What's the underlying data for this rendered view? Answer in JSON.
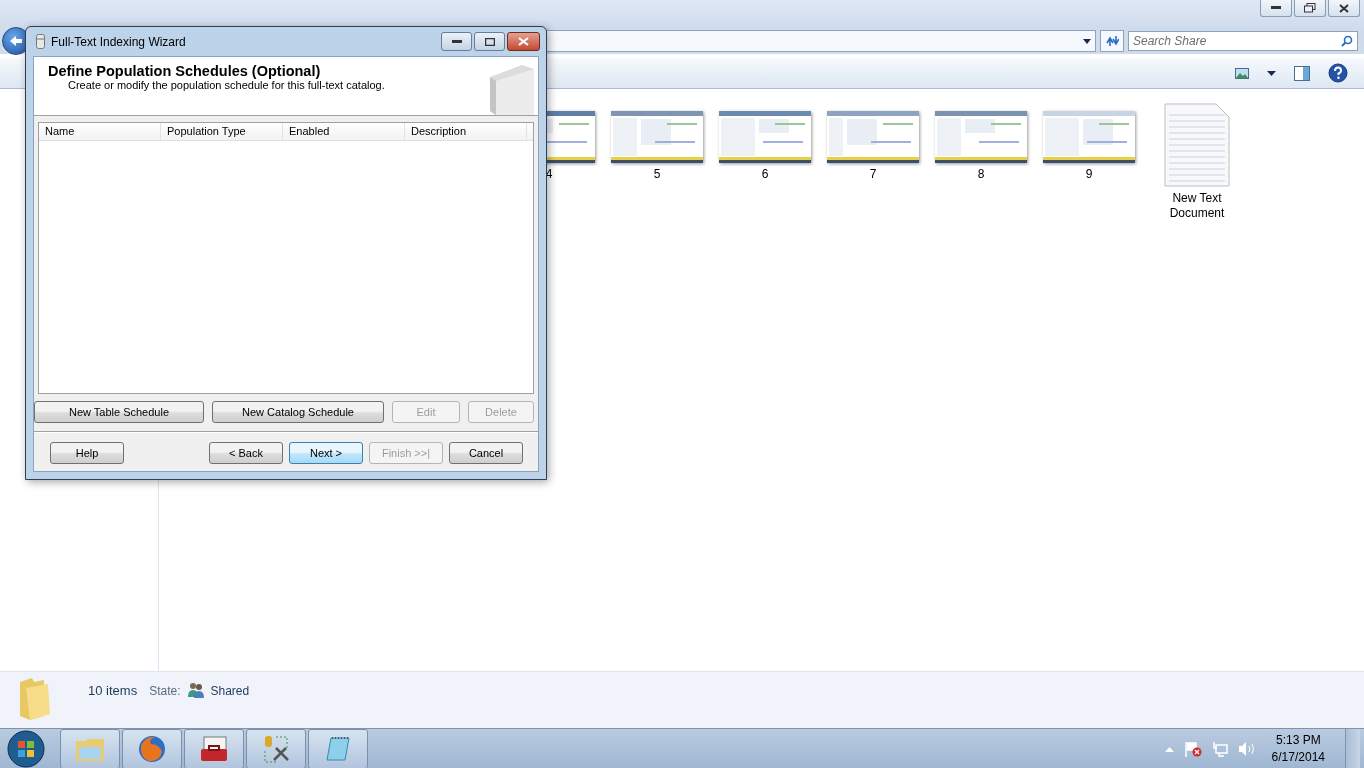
{
  "explorer": {
    "search": {
      "placeholder": "Search Share"
    },
    "items": [
      {
        "label": "4",
        "kind": "picture"
      },
      {
        "label": "5",
        "kind": "picture"
      },
      {
        "label": "6",
        "kind": "picture"
      },
      {
        "label": "7",
        "kind": "picture"
      },
      {
        "label": "8",
        "kind": "picture"
      },
      {
        "label": "9",
        "kind": "picture"
      },
      {
        "label": "New Text Document",
        "kind": "document"
      }
    ],
    "status": {
      "count": "10 items",
      "state_label": "State:",
      "state": "Shared"
    }
  },
  "wizard": {
    "title": "Full-Text Indexing Wizard",
    "heading": "Define Population Schedules (Optional)",
    "subheading": "Create or modify the population schedule for this full-text catalog.",
    "columns": [
      "Name",
      "Population Type",
      "Enabled",
      "Description"
    ],
    "list_buttons": [
      {
        "label": "New Table Schedule",
        "disabled": false
      },
      {
        "label": "New Catalog Schedule",
        "disabled": false
      },
      {
        "label": "Edit",
        "disabled": true
      },
      {
        "label": "Delete",
        "disabled": true
      }
    ],
    "nav_buttons": [
      {
        "label": "Help",
        "disabled": false,
        "default": false
      },
      {
        "label": "< Back",
        "disabled": false,
        "default": false
      },
      {
        "label": "Next >",
        "disabled": false,
        "default": true
      },
      {
        "label": "Finish >>|",
        "disabled": true,
        "default": false
      },
      {
        "label": "Cancel",
        "disabled": false,
        "default": false
      }
    ]
  },
  "taskbar": {
    "time": "5:13 PM",
    "date": "6/17/2014"
  }
}
